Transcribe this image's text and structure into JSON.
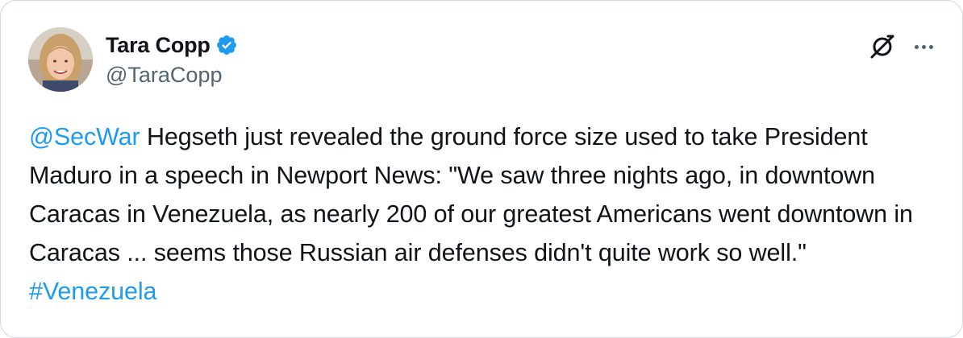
{
  "author": {
    "display_name": "Tara Copp",
    "handle": "@TaraCopp",
    "verified": true,
    "avatar_icon": "profile-photo"
  },
  "actions": {
    "grok_icon": "grok-icon",
    "more_icon": "more-icon"
  },
  "tweet": {
    "mention": "@SecWar",
    "text_before_hashtag": " Hegseth just revealed the ground force size used to take President Maduro in a speech in Newport News: \"We saw three nights ago, in downtown Caracas in Venezuela, as nearly 200 of our greatest Americans went downtown in Caracas ... seems those Russian air defenses didn't quite work so well.\" ",
    "hashtag": "#Venezuela"
  },
  "colors": {
    "link": "#1d9bf0",
    "verified_badge": "#1d9bf0",
    "text": "#0f1419",
    "secondary": "#536471"
  }
}
